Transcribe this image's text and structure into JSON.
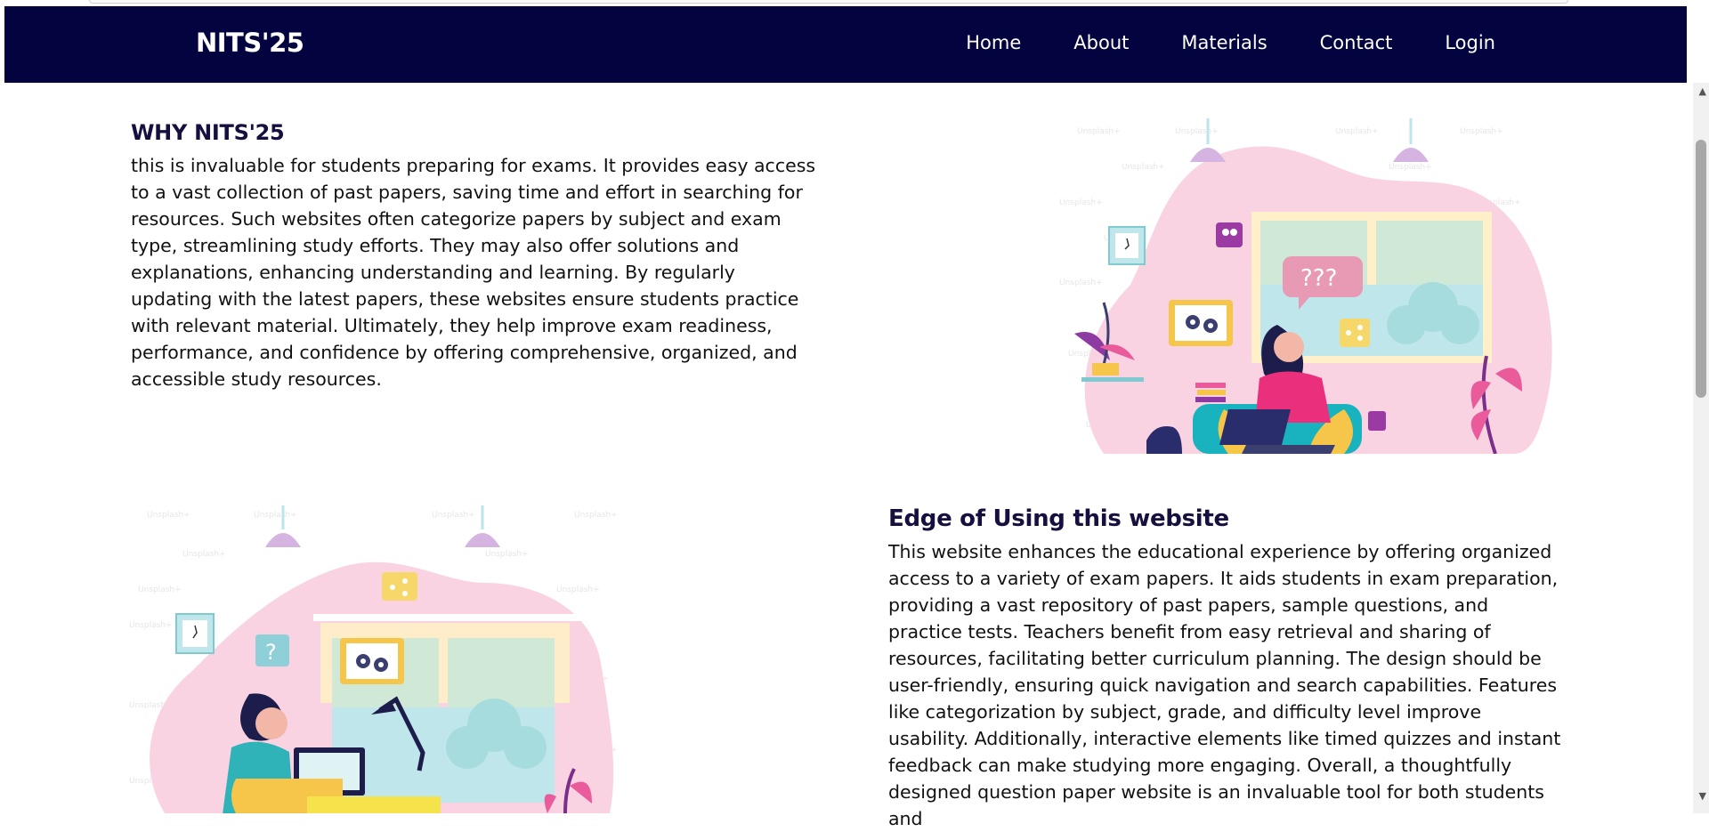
{
  "nav": {
    "brand": "NITS'25",
    "links": [
      "Home",
      "About",
      "Materials",
      "Contact",
      "Login"
    ]
  },
  "section1": {
    "title": "WHY NITS'25",
    "text": "this is invaluable for students preparing for exams. It provides easy access to a vast collection of past papers, saving time and effort in searching for resources. Such websites often categorize papers by subject and exam type, streamlining study efforts. They may also offer solutions and explanations, enhancing understanding and learning. By regularly updating with the latest papers, these websites ensure students practice with relevant material. Ultimately, they help improve exam readiness, performance, and confidence by offering comprehensive, organized, and accessible study resources."
  },
  "section2": {
    "title": "Edge of Using this website",
    "text": "This website enhances the educational experience by offering organized access to a variety of exam papers. It aids students in exam preparation, providing a vast repository of past papers, sample questions, and practice tests. Teachers benefit from easy retrieval and sharing of resources, facilitating better curriculum planning. The design should be user-friendly, ensuring quick navigation and search capabilities. Features like categorization by subject, grade, and difficulty level improve usability. Additionally, interactive elements like timed quizzes and instant feedback can make studying more engaging. Overall, a thoughtfully designed question paper website is an invaluable tool for both students and"
  },
  "illustration1": {
    "bubble_text": "???",
    "watermark": "Unsplash+"
  },
  "illustration2": {
    "bubble_text": "?",
    "watermark": "Unsplash+"
  },
  "colors": {
    "nav_bg": "#03033f",
    "title": "#15103f"
  }
}
